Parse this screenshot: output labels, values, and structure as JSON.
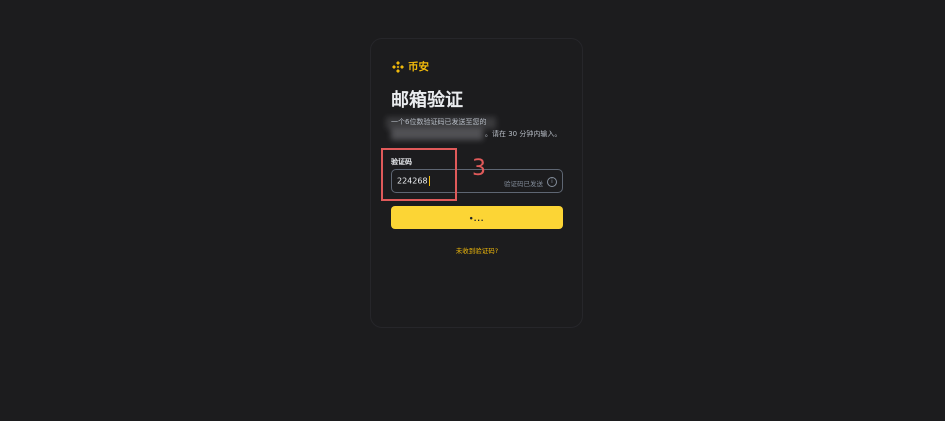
{
  "brand": {
    "name": "币安",
    "color": "#f0b90b"
  },
  "page": {
    "title": "邮箱验证"
  },
  "description": {
    "line1": "一个6位数验证码已发送至您的",
    "line2_suffix": "。请在 30 分钟内输入。"
  },
  "form": {
    "label": "验证码",
    "value": "224268",
    "sent_status": "验证码已发送",
    "info_icon": "info-icon",
    "submit_label": "•..."
  },
  "links": {
    "resend": "未收到验证码?"
  },
  "annotation": {
    "step_number": "3",
    "color": "#e05a5a"
  },
  "colors": {
    "background": "#1c1c1e",
    "accent": "#fcd535"
  }
}
